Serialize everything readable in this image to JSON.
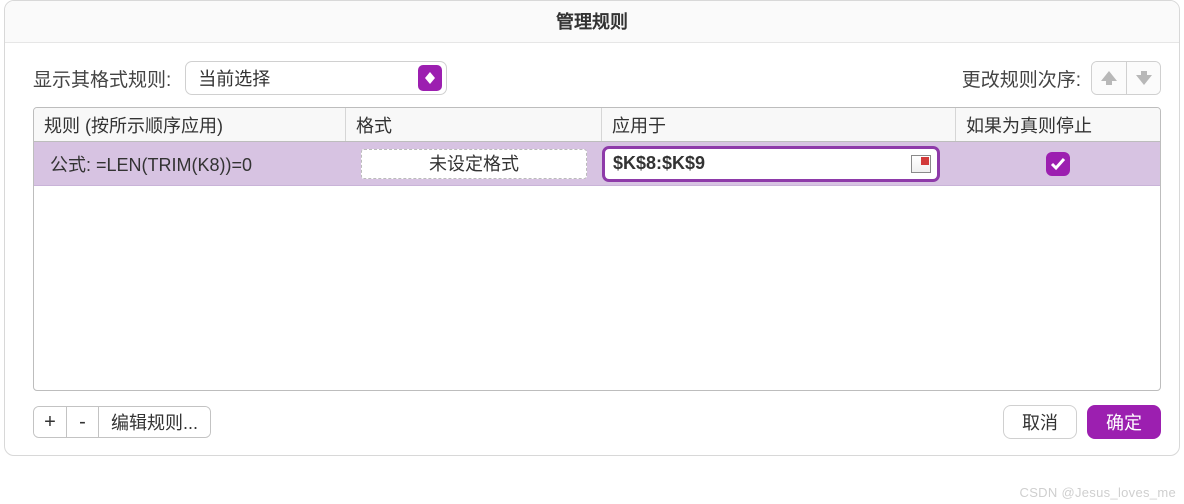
{
  "dialog": {
    "title": "管理规则"
  },
  "toolbar": {
    "show_rules_for_label": "显示其格式规则:",
    "scope_select_value": "当前选择",
    "change_order_label": "更改规则次序:"
  },
  "columns": {
    "rule": "规则 (按所示顺序应用)",
    "format": "格式",
    "applies_to": "应用于",
    "stop_if_true": "如果为真则停止"
  },
  "rules": [
    {
      "description": "公式: =LEN(TRIM(K8))=0",
      "format_preview": "未设定格式",
      "applies_to": "$K$8:$K$9",
      "stop_if_true": true
    }
  ],
  "footer": {
    "add": "+",
    "remove": "-",
    "edit_rule": "编辑规则...",
    "cancel": "取消",
    "ok": "确定"
  },
  "watermark": "CSDN @Jesus_loves_me"
}
